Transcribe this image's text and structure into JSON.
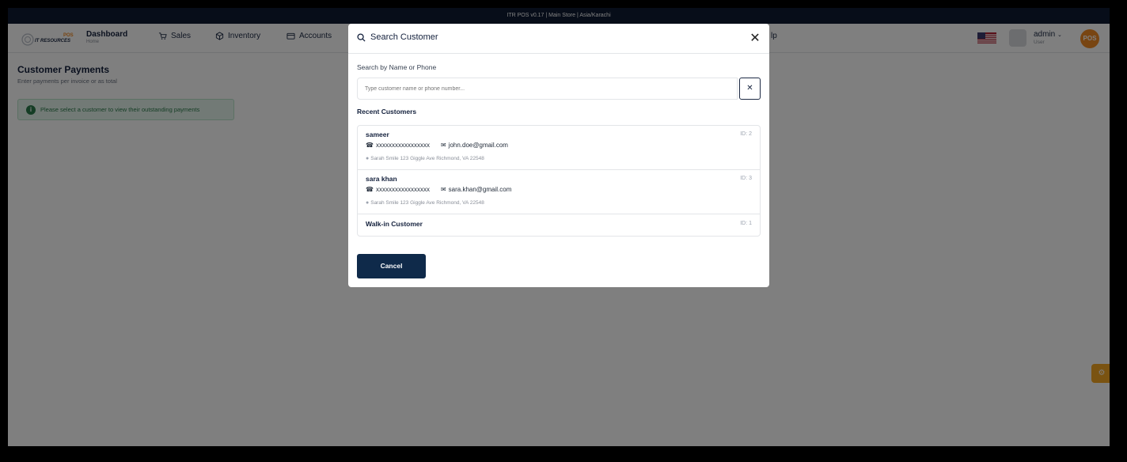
{
  "statusbar": {
    "text": "ITR POS v0.17  |  Main Store  |  Asia/Karachi"
  },
  "navbar": {
    "logo_text": "IT RESOURCES",
    "logo_badge": "POS",
    "dashboard": {
      "title": "Dashboard",
      "subtitle": "Home"
    },
    "items": [
      {
        "label": "Sales",
        "icon": "cart-icon"
      },
      {
        "label": "Inventory",
        "icon": "box-icon"
      },
      {
        "label": "Accounts",
        "icon": "wallet-icon"
      }
    ],
    "partial_item": "lp",
    "user": {
      "name": "admin",
      "role": "User"
    },
    "pos_badge": "POS"
  },
  "page": {
    "title": "Customer Payments",
    "subtitle": "Enter payments per invoice or as total",
    "alert": "Please select a customer to view their outstanding payments"
  },
  "modal": {
    "title": "Search Customer",
    "search_label": "Search by Name or Phone",
    "search_placeholder": "Type customer name or phone number...",
    "recent_label": "Recent Customers",
    "customers": [
      {
        "name": "sameer",
        "id": "ID: 2",
        "phone": "xxxxxxxxxxxxxxxxx",
        "email": "john.doe@gmail.com",
        "address": "Sarah Smile 123 Giggle Ave Richmond, VA 22548"
      },
      {
        "name": "sara khan",
        "id": "ID: 3",
        "phone": "xxxxxxxxxxxxxxxxx",
        "email": "sara.khan@gmail.com",
        "address": "Sarah Smile 123 Giggle Ave Richmond, VA 22548"
      },
      {
        "name": "Walk-in Customer",
        "id": "ID: 1"
      }
    ],
    "cancel_label": "Cancel"
  },
  "colors": {
    "primary": "#0f2a4a",
    "accent": "#f08a24",
    "success": "#2b7a4b"
  }
}
